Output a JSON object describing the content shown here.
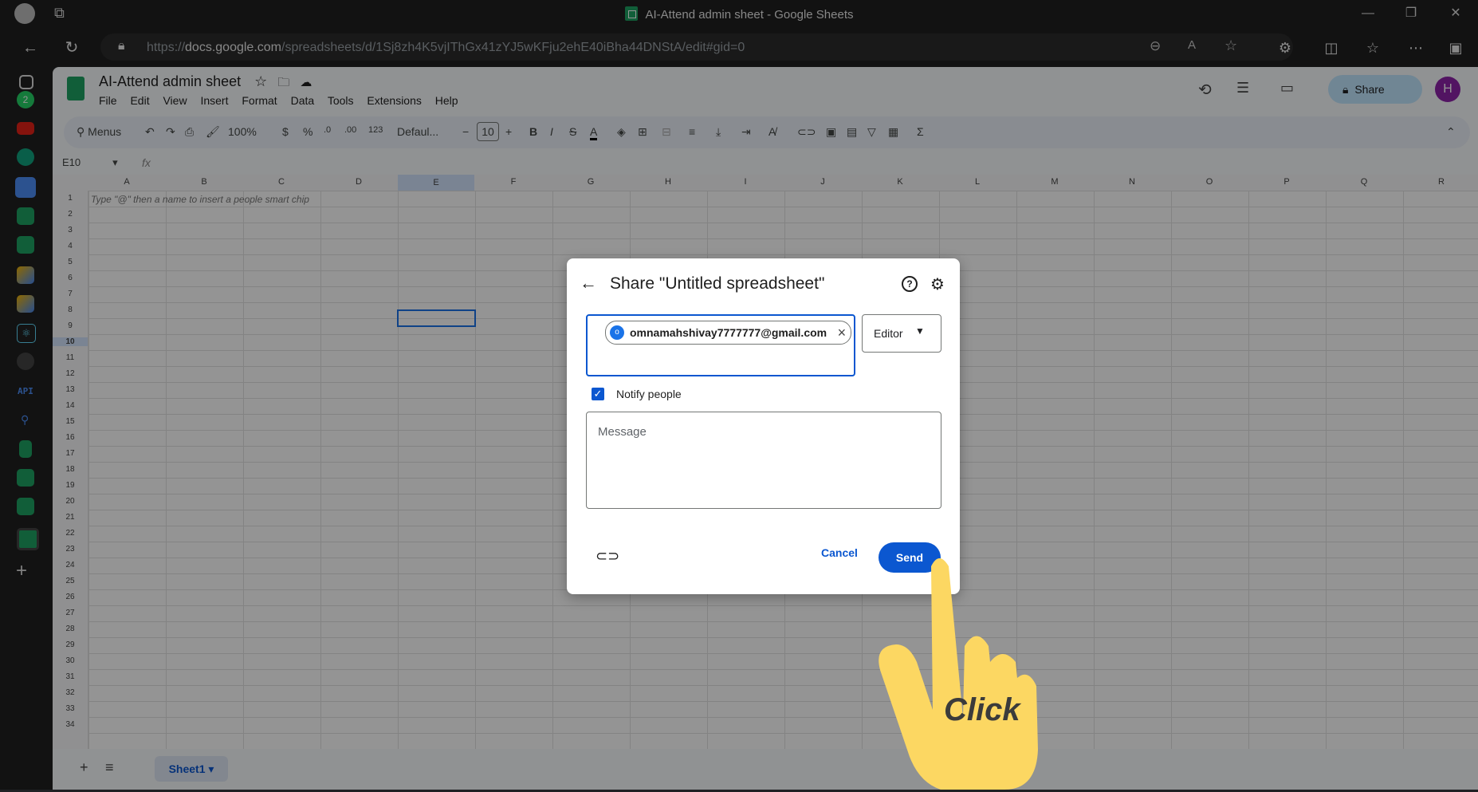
{
  "window": {
    "title": "AI-Attend admin sheet - Google Sheets"
  },
  "browser": {
    "url_domain": "docs.google.com",
    "url_prefix": "https://",
    "url_path": "/spreadsheets/d/1Sj8zh4K5vjIThGx41zYJ5wKFju2ehE40iBha44DNStA/edit#gid=0"
  },
  "edge_sidebar": {
    "badge": "2",
    "api_label": "API"
  },
  "sheets": {
    "doc_title": "AI-Attend admin sheet",
    "menu": [
      "File",
      "Edit",
      "View",
      "Insert",
      "Format",
      "Data",
      "Tools",
      "Extensions",
      "Help"
    ],
    "toolbar": {
      "search": "Menus",
      "zoom": "100%",
      "currency": "$",
      "percent": "%",
      "dec_less": ".0",
      "dec_more": ".00",
      "num_format": "123",
      "font": "Defaul...",
      "font_size": "10"
    },
    "share_label": "Share",
    "avatar_letter": "H",
    "name_box": "E10",
    "fx": "fx",
    "columns": [
      "A",
      "B",
      "C",
      "D",
      "E",
      "F",
      "G",
      "H",
      "I",
      "J",
      "K",
      "L",
      "M",
      "N",
      "O",
      "P",
      "Q",
      "R"
    ],
    "rows": [
      "1",
      "2",
      "3",
      "4",
      "5",
      "6",
      "7",
      "8",
      "9",
      "10",
      "11",
      "12",
      "13",
      "14",
      "15",
      "16",
      "17",
      "18",
      "19",
      "20",
      "21",
      "22",
      "23",
      "24",
      "25",
      "26",
      "27",
      "28",
      "29",
      "30",
      "31",
      "32",
      "33",
      "34"
    ],
    "cell_hint": "Type \"@\" then a name to insert a people smart chip",
    "sheet_tab": "Sheet1"
  },
  "share_dialog": {
    "title": "Share \"Untitled spreadsheet\"",
    "chip_email": "omnamahshivay7777777@gmail.com",
    "chip_initial": "o",
    "role": "Editor",
    "notify_label": "Notify people",
    "notify_checked": true,
    "message_placeholder": "Message",
    "cancel_label": "Cancel",
    "send_label": "Send"
  },
  "annotation": {
    "click_label": "Click",
    "hand_color": "#fcd762"
  }
}
